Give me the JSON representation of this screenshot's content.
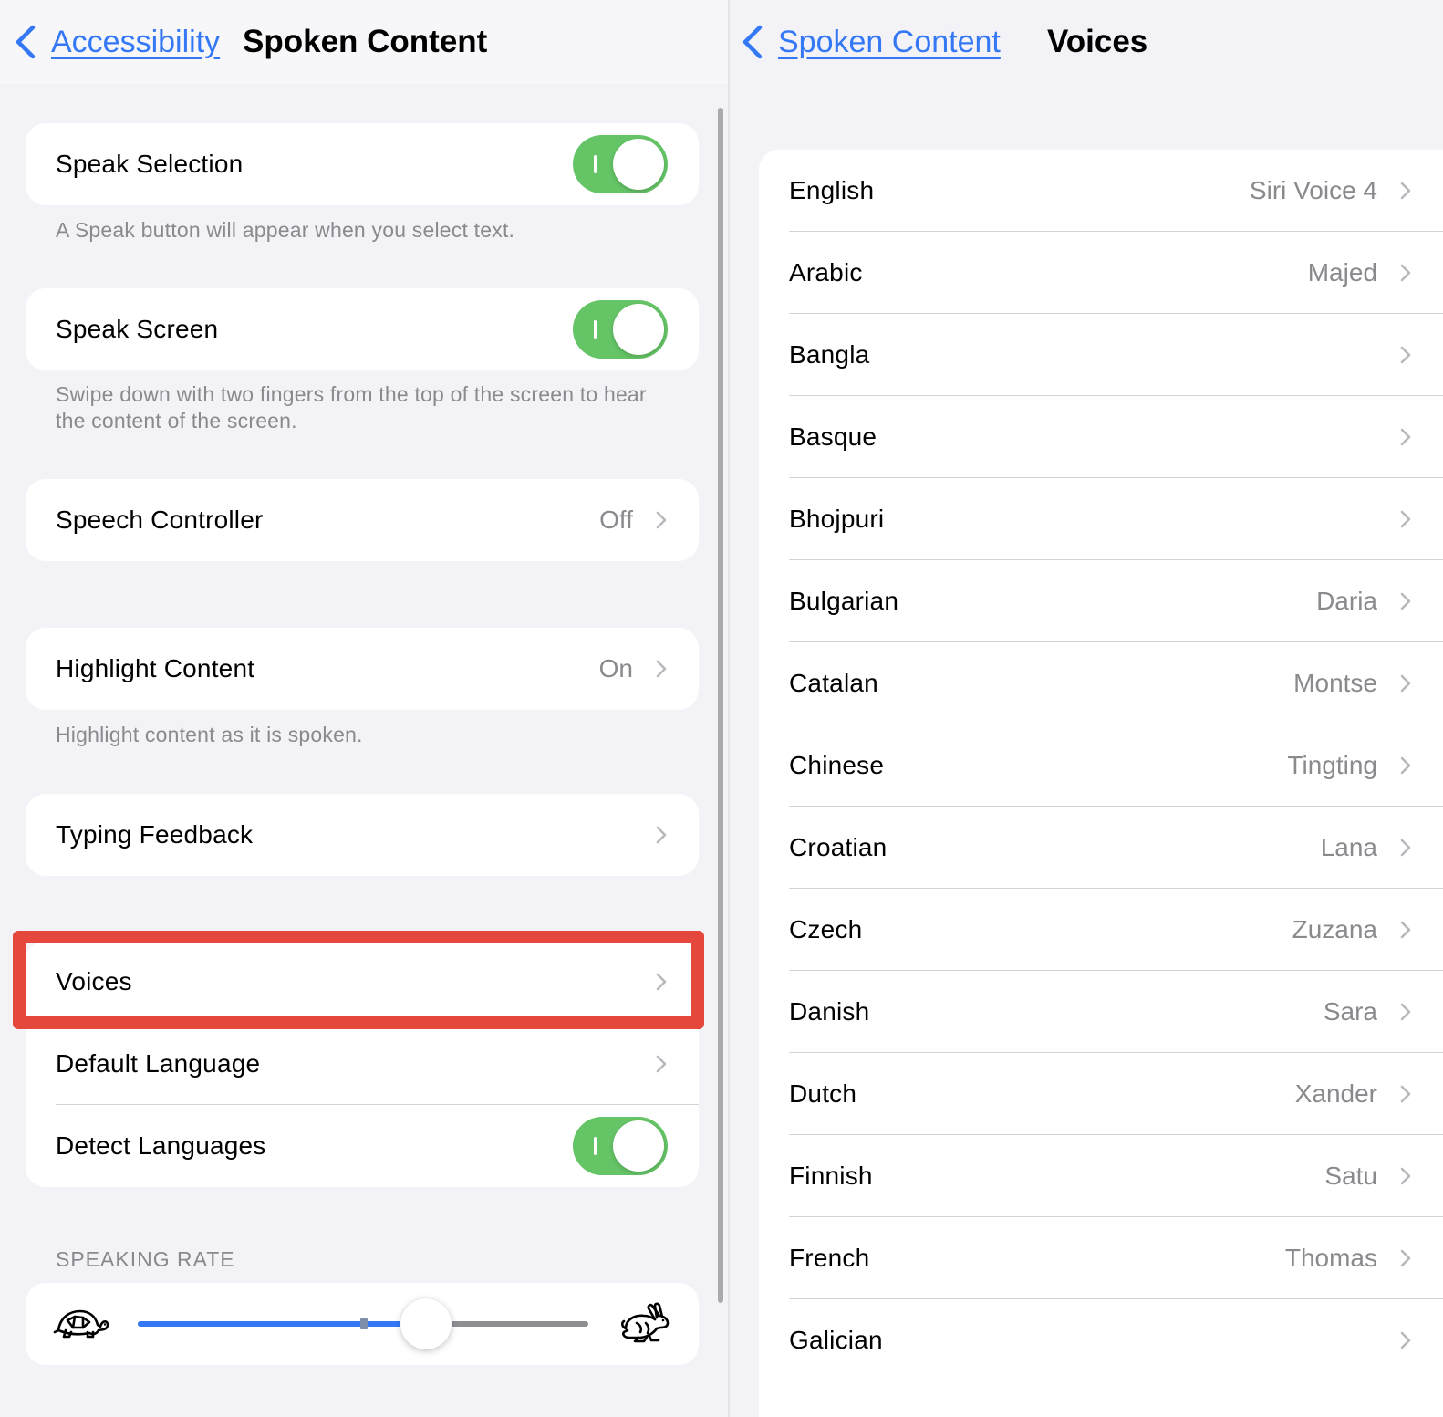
{
  "left_pane": {
    "back_label": "Accessibility",
    "title": "Spoken Content",
    "speak_selection": {
      "label": "Speak Selection",
      "enabled": true,
      "footnote": "A Speak button will appear when you select text."
    },
    "speak_screen": {
      "label": "Speak Screen",
      "enabled": true,
      "footnote": "Swipe down with two fingers from the top of the screen to hear the content of the screen."
    },
    "speech_controller": {
      "label": "Speech Controller",
      "value": "Off"
    },
    "highlight_content": {
      "label": "Highlight Content",
      "value": "On",
      "footnote": "Highlight content as it is spoken."
    },
    "typing_feedback": {
      "label": "Typing Feedback"
    },
    "voices": {
      "label": "Voices"
    },
    "default_language": {
      "label": "Default Language"
    },
    "detect_languages": {
      "label": "Detect Languages",
      "enabled": true
    },
    "speaking_rate": {
      "header": "SPEAKING RATE",
      "value": 0.64,
      "slow_icon": "turtle-icon",
      "fast_icon": "rabbit-icon"
    }
  },
  "right_pane": {
    "back_label": "Spoken Content",
    "title": "Voices",
    "languages": [
      {
        "label": "English",
        "value": "Siri Voice 4"
      },
      {
        "label": "Arabic",
        "value": "Majed"
      },
      {
        "label": "Bangla",
        "value": ""
      },
      {
        "label": "Basque",
        "value": ""
      },
      {
        "label": "Bhojpuri",
        "value": ""
      },
      {
        "label": "Bulgarian",
        "value": "Daria"
      },
      {
        "label": "Catalan",
        "value": "Montse"
      },
      {
        "label": "Chinese",
        "value": "Tingting"
      },
      {
        "label": "Croatian",
        "value": "Lana"
      },
      {
        "label": "Czech",
        "value": "Zuzana"
      },
      {
        "label": "Danish",
        "value": "Sara"
      },
      {
        "label": "Dutch",
        "value": "Xander"
      },
      {
        "label": "Finnish",
        "value": "Satu"
      },
      {
        "label": "French",
        "value": "Thomas"
      },
      {
        "label": "Galician",
        "value": ""
      }
    ]
  },
  "colors": {
    "accent": "#3478f6",
    "toggle_on": "#65c466",
    "highlight": "#e5473c",
    "secondary_text": "#8a8a8e",
    "background": "#f2f2f7"
  }
}
